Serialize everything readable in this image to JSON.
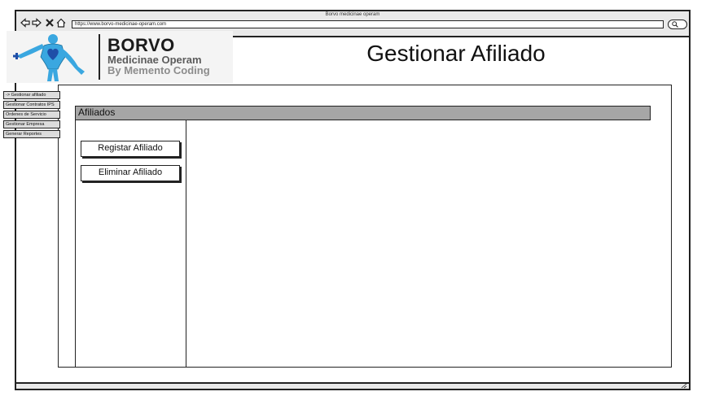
{
  "window": {
    "title": "Borvo medicinae operam",
    "url": "https://www.borvo-medicinae-operam.com"
  },
  "icons": {
    "back": "back-arrow-icon",
    "forward": "forward-arrow-icon",
    "stop": "close-icon",
    "home": "home-icon",
    "search": "search-icon",
    "grip": "resize-grip-icon"
  },
  "logo": {
    "title": "BORVO",
    "subtitle": "Medicinae Operam",
    "byline": "By Memento Coding",
    "colors": {
      "accent": "#3aa7e0",
      "heart": "#1f4fa8"
    }
  },
  "page": {
    "title": "Gestionar Afiliado"
  },
  "sidebar": {
    "items": [
      {
        "label": "-> Gestionar afiliado"
      },
      {
        "label": "Gestionar Contratos IPS"
      },
      {
        "label": "Ordenes de Servicio"
      },
      {
        "label": "Gestionar Empresa"
      },
      {
        "label": "Generar Reportes"
      }
    ]
  },
  "section": {
    "title": "Afiliados",
    "actions": [
      {
        "label": "Registar Afiliado"
      },
      {
        "label": "Eliminar Afiliado"
      }
    ]
  },
  "colors": {
    "header_bg": "#a6a6a6",
    "chrome_bg": "#e9e9e9"
  }
}
